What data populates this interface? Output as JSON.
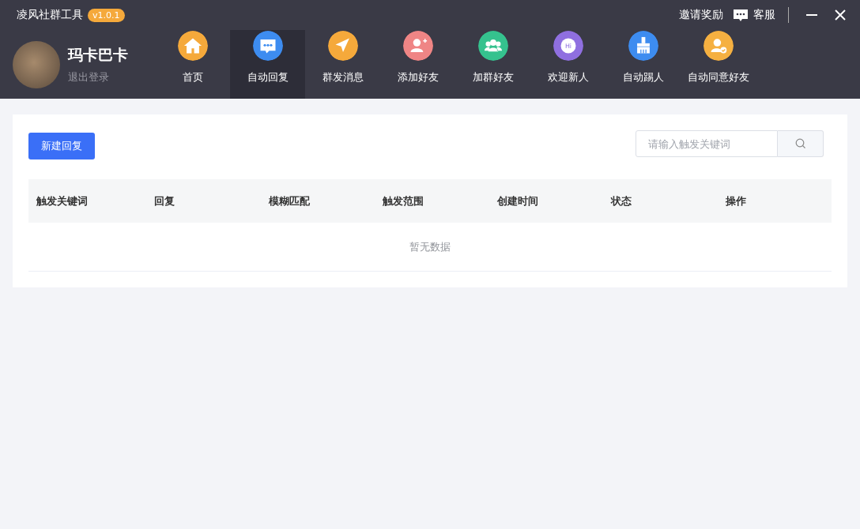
{
  "app": {
    "title": "凌风社群工具",
    "version": "v1.0.1"
  },
  "header_links": {
    "invite": "邀请奖励",
    "support": "客服"
  },
  "user": {
    "name": "玛卡巴卡",
    "logout": "退出登录"
  },
  "nav": [
    {
      "label": "首页",
      "kind": "home",
      "color": "#f5a93b",
      "selected": false
    },
    {
      "label": "自动回复",
      "kind": "chat",
      "color": "#3d8cf0",
      "selected": true
    },
    {
      "label": "群发消息",
      "kind": "send",
      "color": "#f5a93b",
      "selected": false
    },
    {
      "label": "添加好友",
      "kind": "add-user",
      "color": "#ef8585",
      "selected": false
    },
    {
      "label": "加群好友",
      "kind": "group",
      "color": "#35c28e",
      "selected": false
    },
    {
      "label": "欢迎新人",
      "kind": "hi",
      "icon_text": "Hi",
      "color": "#8f6fe0",
      "selected": false
    },
    {
      "label": "自动踢人",
      "kind": "broom",
      "color": "#3d8cf0",
      "selected": false
    },
    {
      "label": "自动同意好友",
      "kind": "user-check",
      "color": "#f5b041",
      "selected": false
    }
  ],
  "toolbar": {
    "new_button": "新建回复",
    "search": {
      "placeholder": "请输入触发关键词"
    }
  },
  "table": {
    "columns": [
      "触发关键词",
      "回复",
      "模糊匹配",
      "触发范围",
      "创建时间",
      "状态",
      "操作"
    ],
    "empty_text": "暂无数据"
  }
}
